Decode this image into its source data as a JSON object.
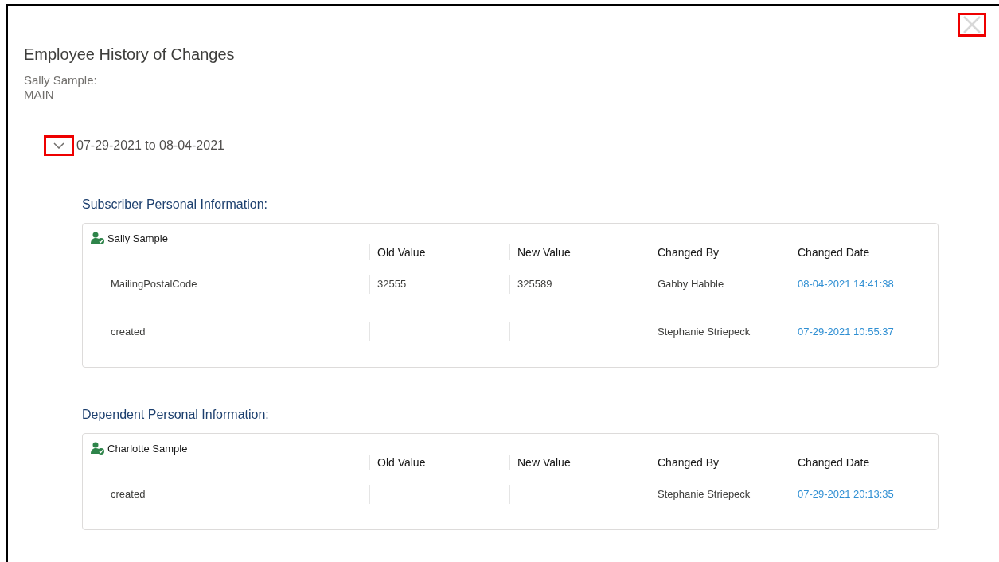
{
  "dialog": {
    "title": "Employee History of Changes",
    "subject": "Sally Sample:",
    "plan": "MAIN"
  },
  "period": {
    "label": "07-29-2021 to 08-04-2021",
    "expanded": true
  },
  "sections": [
    {
      "heading": "Subscriber Personal Information:",
      "person": "Sally Sample",
      "columns": [
        "Old Value",
        "New Value",
        "Changed By",
        "Changed Date"
      ],
      "rows": [
        {
          "field": "MailingPostalCode",
          "old_value": "32555",
          "new_value": "325589",
          "changed_by": "Gabby Habble",
          "changed_date": "08-04-2021 14:41:38"
        },
        {
          "field": "created",
          "changed_by": "Stephanie Striepeck",
          "changed_date": "07-29-2021 10:55:37"
        }
      ]
    },
    {
      "heading": "Dependent Personal Information:",
      "person": "Charlotte Sample",
      "columns": [
        "Old Value",
        "New Value",
        "Changed By",
        "Changed Date"
      ],
      "rows": [
        {
          "field": "created",
          "changed_by": "Stephanie Striepeck",
          "changed_date": "07-29-2021 20:13:35"
        }
      ]
    }
  ]
}
